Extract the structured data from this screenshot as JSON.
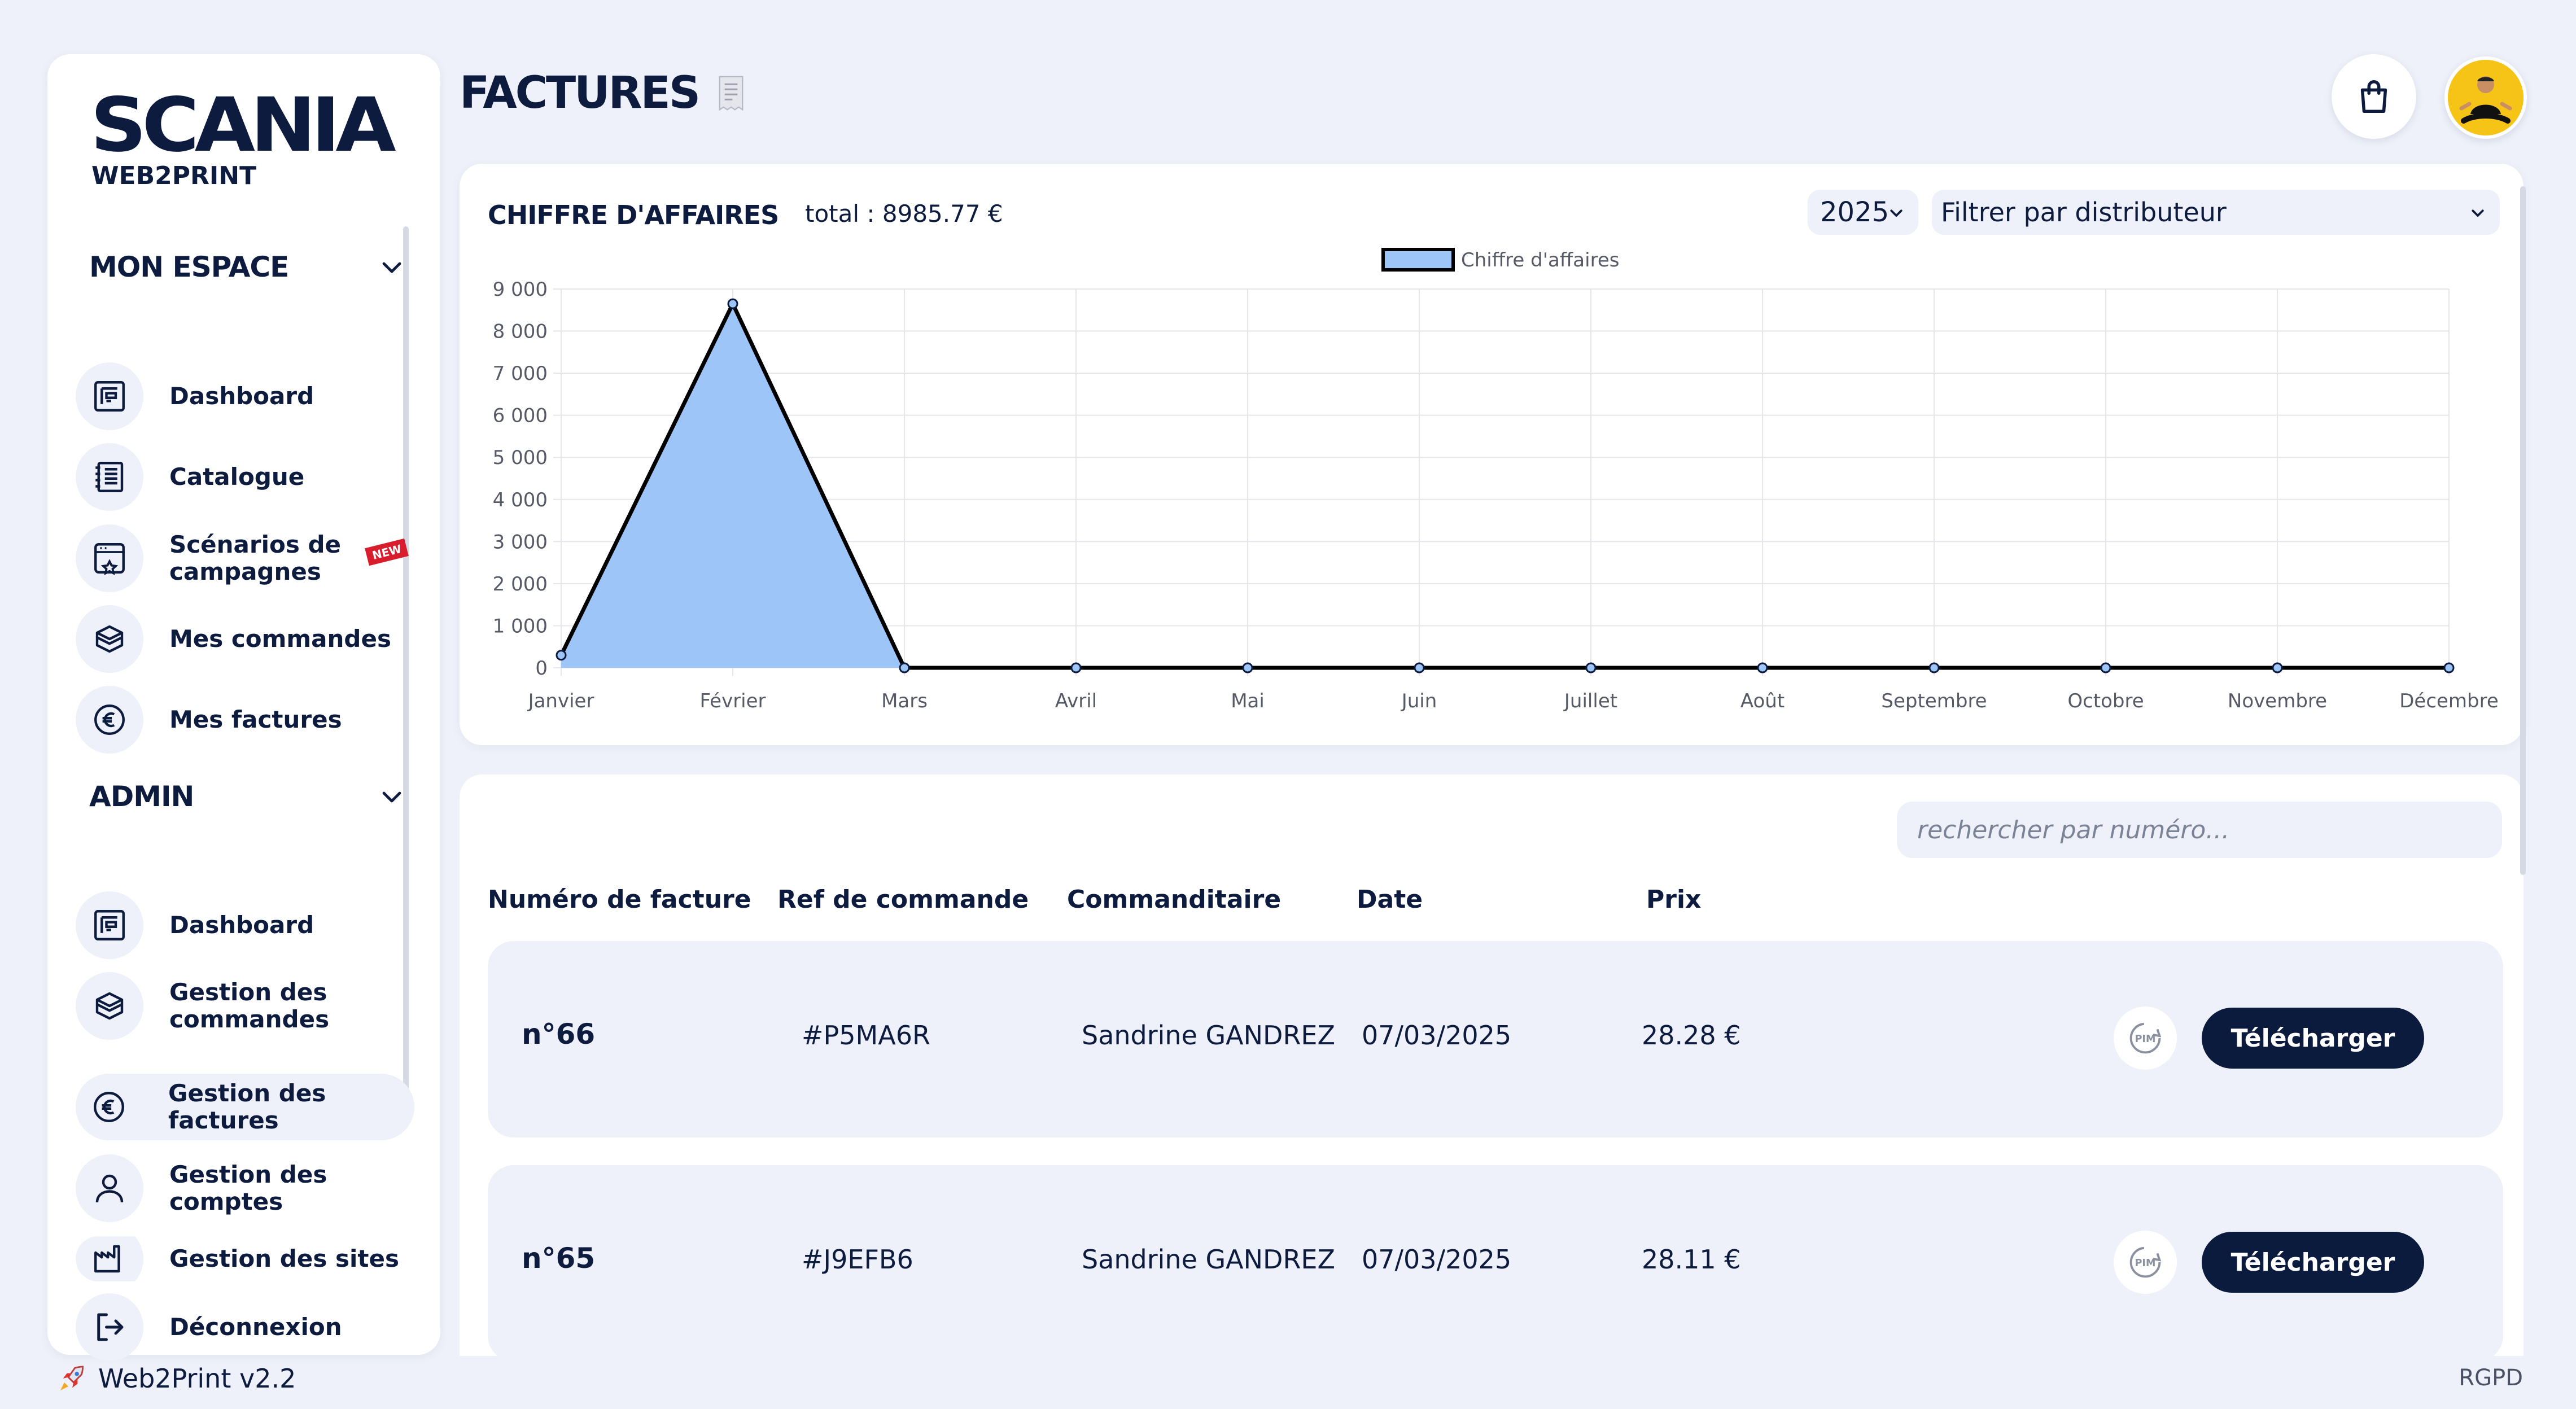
{
  "brand": {
    "logo": "SCANIA",
    "sub": "WEB2PRINT"
  },
  "sidebar": {
    "sections": [
      {
        "title": "MON ESPACE",
        "items": [
          {
            "label": "Dashboard",
            "icon": "dashboard-icon"
          },
          {
            "label": "Catalogue",
            "icon": "catalogue-icon"
          },
          {
            "label": "Scénarios de campagnes",
            "icon": "campaign-icon",
            "badge": "NEW"
          },
          {
            "label": "Mes commandes",
            "icon": "box-icon"
          },
          {
            "label": "Mes factures",
            "icon": "euro-icon"
          }
        ]
      },
      {
        "title": "ADMIN",
        "items": [
          {
            "label": "Dashboard",
            "icon": "dashboard-icon"
          },
          {
            "label": "Gestion des commandes",
            "icon": "box-icon"
          },
          {
            "label": "Gestion des factures",
            "icon": "euro-icon",
            "active": true
          },
          {
            "label": "Gestion des comptes",
            "icon": "user-icon"
          },
          {
            "label": "Gestion des sites",
            "icon": "factory-icon"
          }
        ]
      }
    ],
    "logout": "Déconnexion"
  },
  "header": {
    "title": "FACTURES"
  },
  "chart_card": {
    "title": "CHIFFRE D'AFFAIRES",
    "total": "total : 8985.77 €",
    "year": "2025",
    "distributor_placeholder": "Filtrer par distributeur"
  },
  "chart_data": {
    "type": "area",
    "categories": [
      "Janvier",
      "Février",
      "Mars",
      "Avril",
      "Mai",
      "Juin",
      "Juillet",
      "Août",
      "Septembre",
      "Octobre",
      "Novembre",
      "Décembre"
    ],
    "series": [
      {
        "name": "Chiffre d'affaires",
        "values": [
          300,
          8650,
          0,
          0,
          0,
          0,
          0,
          0,
          0,
          0,
          0,
          0
        ]
      }
    ],
    "yticks": [
      "0",
      "1 000",
      "2 000",
      "3 000",
      "4 000",
      "5 000",
      "6 000",
      "7 000",
      "8 000",
      "9 000"
    ],
    "ylim": [
      0,
      9000
    ],
    "grid": true,
    "legend": "top-center",
    "colors": {
      "fill": "#9ec5f7",
      "line": "#000000"
    }
  },
  "table": {
    "search_placeholder": "rechercher par numéro...",
    "headers": [
      "Numéro de facture",
      "Ref de commande",
      "Commanditaire",
      "Date",
      "Prix"
    ],
    "rows": [
      {
        "num": "n°66",
        "ref": "#P5MA6R",
        "client": "Sandrine GANDREZ",
        "date": "07/03/2025",
        "price": "28.28 €",
        "action": "Télécharger"
      },
      {
        "num": "n°65",
        "ref": "#J9EFB6",
        "client": "Sandrine GANDREZ",
        "date": "07/03/2025",
        "price": "28.11 €",
        "action": "Télécharger"
      }
    ]
  },
  "footer": {
    "version": "Web2Print v2.2",
    "rgpd": "RGPD"
  }
}
